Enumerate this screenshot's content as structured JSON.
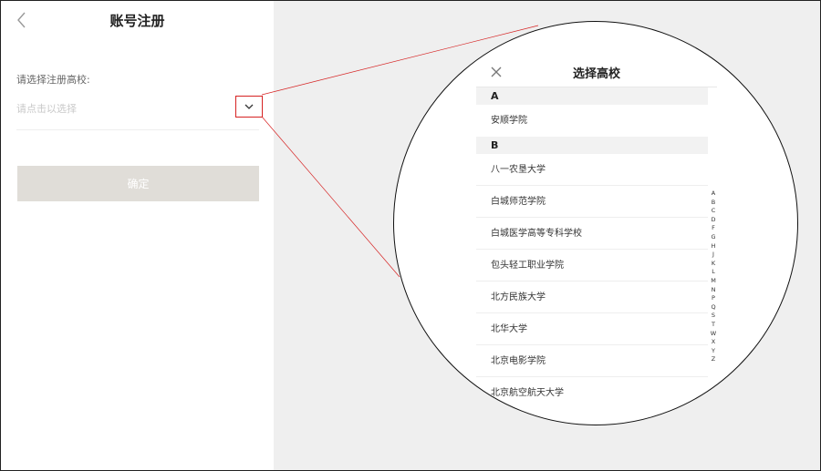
{
  "colors": {
    "accent_red": "#d62222",
    "button_disabled_bg": "#e0ddd8",
    "section_bg": "#f2f2f2",
    "right_bg": "#efefef"
  },
  "registration": {
    "title": "账号注册",
    "back_icon": "chevron-left-icon",
    "field_label": "请选择注册高校:",
    "field_placeholder": "请点击以选择",
    "dropdown_icon": "chevron-down-icon",
    "confirm_label": "确定"
  },
  "school_picker": {
    "title": "选择高校",
    "close_icon": "close-icon",
    "sections": [
      {
        "letter": "A",
        "schools": [
          "安顺学院"
        ]
      },
      {
        "letter": "B",
        "schools": [
          "八一农垦大学",
          "白城师范学院",
          "白城医学高等专科学校",
          "包头轻工职业学院",
          "北方民族大学",
          "北华大学",
          "北京电影学院",
          "北京航空航天大学"
        ]
      }
    ],
    "alphabet_index": [
      "A",
      "B",
      "C",
      "D",
      "F",
      "G",
      "H",
      "J",
      "K",
      "L",
      "M",
      "N",
      "P",
      "Q",
      "S",
      "T",
      "W",
      "X",
      "Y",
      "Z"
    ]
  }
}
